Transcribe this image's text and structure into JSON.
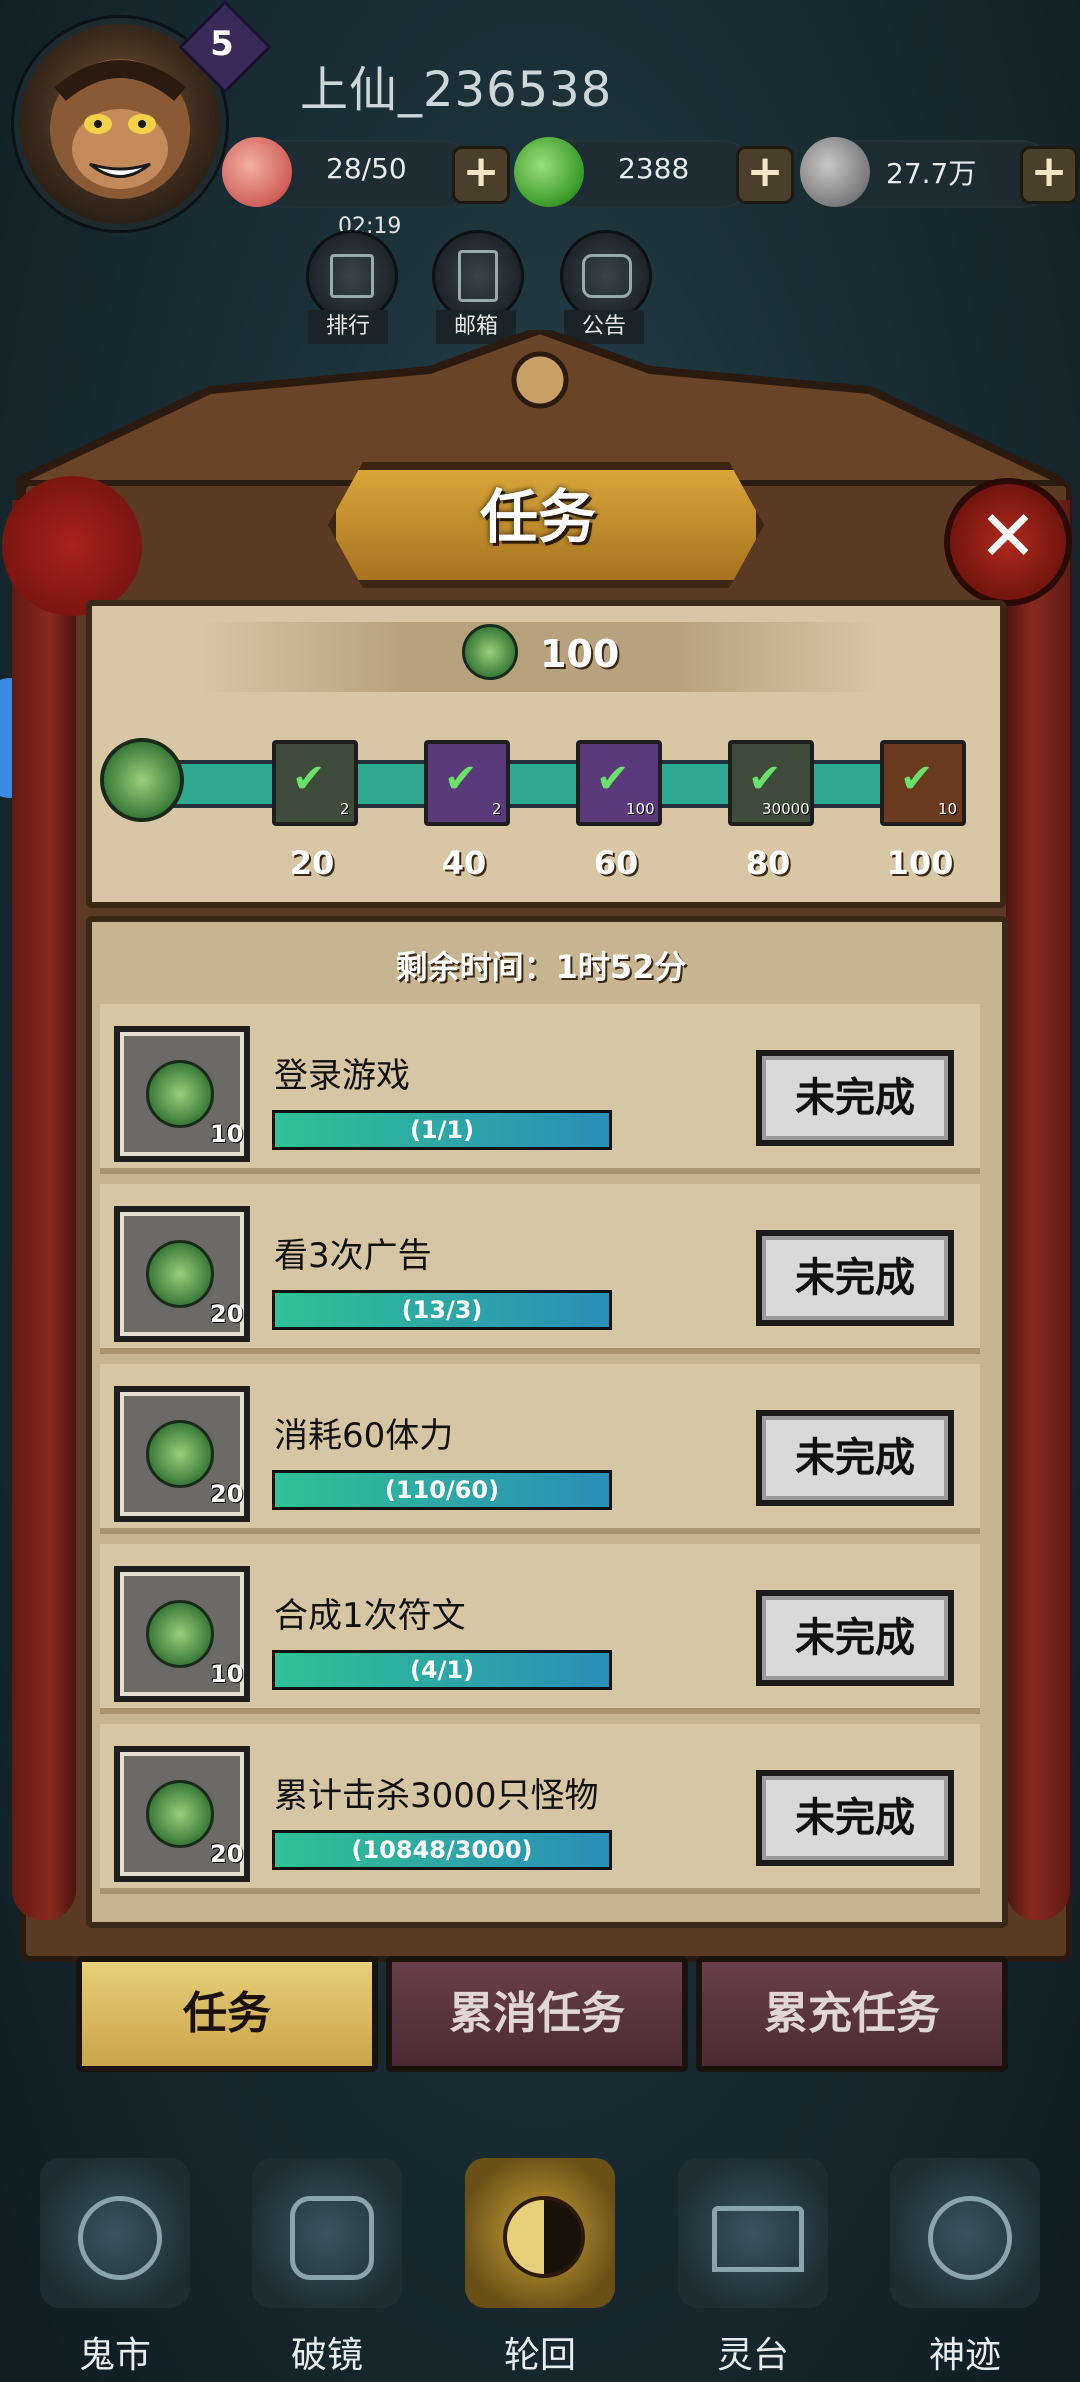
{
  "header": {
    "level": "5",
    "username": "上仙_236538",
    "resources": [
      {
        "icon": "peach-icon",
        "value": "28/50"
      },
      {
        "icon": "jade-dragon-icon",
        "value": "2388"
      },
      {
        "icon": "coin-icon",
        "value": "27.7万"
      }
    ],
    "timer": "02:19",
    "buttons": [
      {
        "icon": "ranking-icon",
        "label": "排行"
      },
      {
        "icon": "mail-icon",
        "label": "邮箱"
      },
      {
        "icon": "notice-icon",
        "label": "公告"
      }
    ]
  },
  "panel": {
    "title": "任务",
    "close_icon": "close-icon",
    "score": "100",
    "milestones": [
      {
        "label": "20",
        "count": "2",
        "color": "#3e4a3a"
      },
      {
        "label": "40",
        "count": "2",
        "color": "#5a3a7a"
      },
      {
        "label": "60",
        "count": "100",
        "color": "#5a3a7a"
      },
      {
        "label": "80",
        "count": "30000",
        "color": "#3e4a3a"
      },
      {
        "label": "100",
        "count": "10",
        "color": "#6a3a1e"
      }
    ],
    "remaining_time": "剩余时间：1时52分",
    "tasks": [
      {
        "name": "登录游戏",
        "reward": "10",
        "progress": "(1/1)",
        "status": "未完成"
      },
      {
        "name": "看3次广告",
        "reward": "20",
        "progress": "(13/3)",
        "status": "未完成"
      },
      {
        "name": "消耗60体力",
        "reward": "20",
        "progress": "(110/60)",
        "status": "未完成"
      },
      {
        "name": "合成1次符文",
        "reward": "10",
        "progress": "(4/1)",
        "status": "未完成"
      },
      {
        "name": "累计击杀3000只怪物",
        "reward": "20",
        "progress": "(10848/3000)",
        "status": "未完成"
      }
    ]
  },
  "tabs": [
    {
      "label": "任务",
      "active": true
    },
    {
      "label": "累消任务",
      "active": false
    },
    {
      "label": "累充任务",
      "active": false
    }
  ],
  "nav": [
    {
      "label": "鬼市",
      "icon": "ghost-market-icon"
    },
    {
      "label": "破镜",
      "icon": "mirror-icon"
    },
    {
      "label": "轮回",
      "icon": "yin-yang-icon"
    },
    {
      "label": "灵台",
      "icon": "altar-icon"
    },
    {
      "label": "神迹",
      "icon": "miracle-icon"
    }
  ]
}
